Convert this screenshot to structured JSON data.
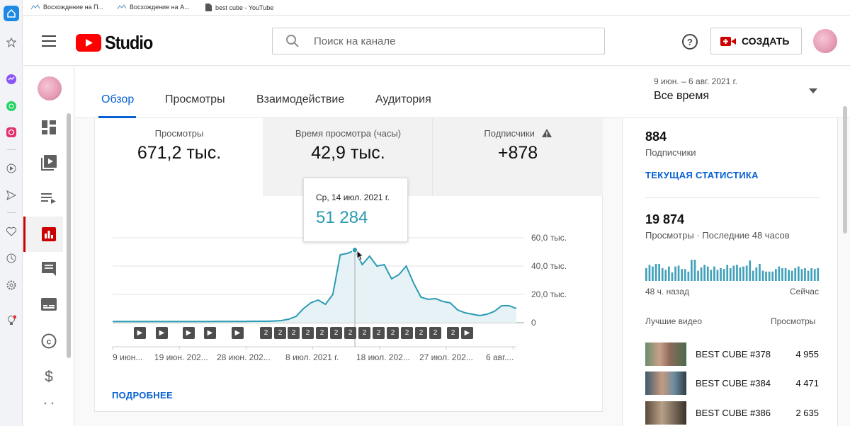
{
  "bookmarks": [
    {
      "label": "Восхождение на П..."
    },
    {
      "label": "Восхождение на А..."
    },
    {
      "label": "best cube - YouTube"
    }
  ],
  "header": {
    "logo_text": "Studio",
    "search_placeholder": "Поиск на канале",
    "create_label": "СОЗДАТЬ"
  },
  "tabs": [
    "Обзор",
    "Просмотры",
    "Взаимодействие",
    "Аудитория"
  ],
  "date_range": {
    "range": "9 июн. – 6 авг. 2021 г.",
    "selected": "Все время"
  },
  "metrics": [
    {
      "label": "Просмотры",
      "value": "671,2 тыс."
    },
    {
      "label": "Время просмотра (часы)",
      "value": "42,9 тыс."
    },
    {
      "label": "Подписчики",
      "value": "+878"
    }
  ],
  "tooltip": {
    "date": "Ср, 14 июл. 2021 г.",
    "value": "51 284"
  },
  "chart_data": {
    "type": "area",
    "y_ticks": [
      "60,0 тыс.",
      "40,0 тыс.",
      "20,0 тыс.",
      "0"
    ],
    "ylim": [
      0,
      60000
    ],
    "x_ticks": [
      "9 июн...",
      "19 июн. 202...",
      "28 июн. 202...",
      "8 июл. 2021 г.",
      "18 июл. 202...",
      "27 июл. 202...",
      "6 авг...."
    ],
    "series": [
      {
        "values": [
          800,
          800,
          800,
          800,
          800,
          800,
          800,
          800,
          800,
          800,
          800,
          800,
          800,
          800,
          900,
          900,
          900,
          900,
          900,
          1000,
          1000,
          1000,
          1200,
          1500,
          2500,
          4500,
          10000,
          14000,
          16000,
          13000,
          20000,
          48000,
          49000,
          51284,
          41000,
          47000,
          40000,
          41000,
          31000,
          34000,
          40000,
          28000,
          18000,
          16500,
          17000,
          15000,
          14000,
          9000,
          7000,
          6000,
          5000,
          6000,
          8000,
          12000,
          12000,
          10000
        ]
      }
    ],
    "highlight_index": 33
  },
  "markers": [
    "▶",
    "▶",
    "▶",
    "▶",
    "▶",
    "2",
    "2",
    "2",
    "2",
    "2",
    "2",
    "2",
    "2",
    "2",
    "2",
    "2",
    "2",
    "2",
    "2",
    "▶"
  ],
  "details_link": "ПОДРОБНЕЕ",
  "sidebar": {
    "subs_count": "884",
    "subs_label": "Подписчики",
    "realtime_link": "ТЕКУЩАЯ СТАТИСТИКА",
    "views48": "19 874",
    "views48_label": "Просмотры · Последние 48 часов",
    "mini_chart": {
      "type": "bar",
      "values": [
        15,
        19,
        17,
        20,
        20,
        15,
        13,
        17,
        10,
        17,
        18,
        14,
        14,
        11,
        25,
        25,
        12,
        16,
        19,
        17,
        13,
        17,
        13,
        15,
        14,
        19,
        15,
        18,
        19,
        16,
        17,
        18,
        24,
        12,
        16,
        20,
        12,
        11,
        11,
        11,
        14,
        17,
        15,
        15,
        13,
        12,
        15,
        17,
        14,
        15,
        12,
        15,
        14,
        15
      ]
    },
    "left_label": "48 ч. назад",
    "right_label": "Сейчас",
    "top_header": "Лучшие видео",
    "views_header": "Просмотры",
    "videos": [
      {
        "title": "BEST CUBE #378",
        "views": "4 955"
      },
      {
        "title": "BEST CUBE #384",
        "views": "4 471"
      },
      {
        "title": "BEST CUBE #386",
        "views": "2 635"
      }
    ]
  },
  "colors": {
    "accent": "#065fd4",
    "line": "#2b9bb3",
    "youtube_red": "#ff0000",
    "tooltip_value": "#2b9bb3"
  }
}
